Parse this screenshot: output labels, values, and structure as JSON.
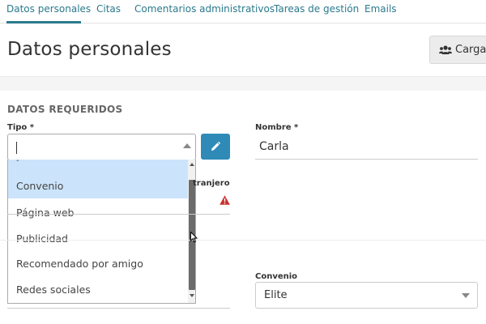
{
  "tabs": [
    {
      "label": "Datos personales",
      "active": true
    },
    {
      "label": "Citas"
    },
    {
      "label": "Comentarios administrativos"
    },
    {
      "label": "Tareas de gestión"
    },
    {
      "label": "Emails"
    }
  ],
  "header": {
    "title": "Datos personales",
    "cargas_label": "Cargas",
    "cargas_icon": "users-icon"
  },
  "form": {
    "section_title": "DATOS REQUERIDOS",
    "tipo": {
      "label": "Tipo *",
      "search_value": "",
      "partial_option": "-",
      "options": [
        {
          "label": "Convenio",
          "highlighted": true
        },
        {
          "label": "Página web"
        },
        {
          "label": "Publicidad"
        },
        {
          "label": "Recomendado por amigo"
        },
        {
          "label": "Redes sociales"
        }
      ]
    },
    "hidden_field_label_fragment": "tranjero",
    "nombre": {
      "label": "Nombre *",
      "value": "Carla"
    },
    "convenio": {
      "label": "Convenio",
      "value": "Elite"
    }
  },
  "colors": {
    "accent": "#2a7a8c",
    "edit_button": "#2f8ab7",
    "highlight": "#cce4fb",
    "warning": "#c9302c"
  }
}
